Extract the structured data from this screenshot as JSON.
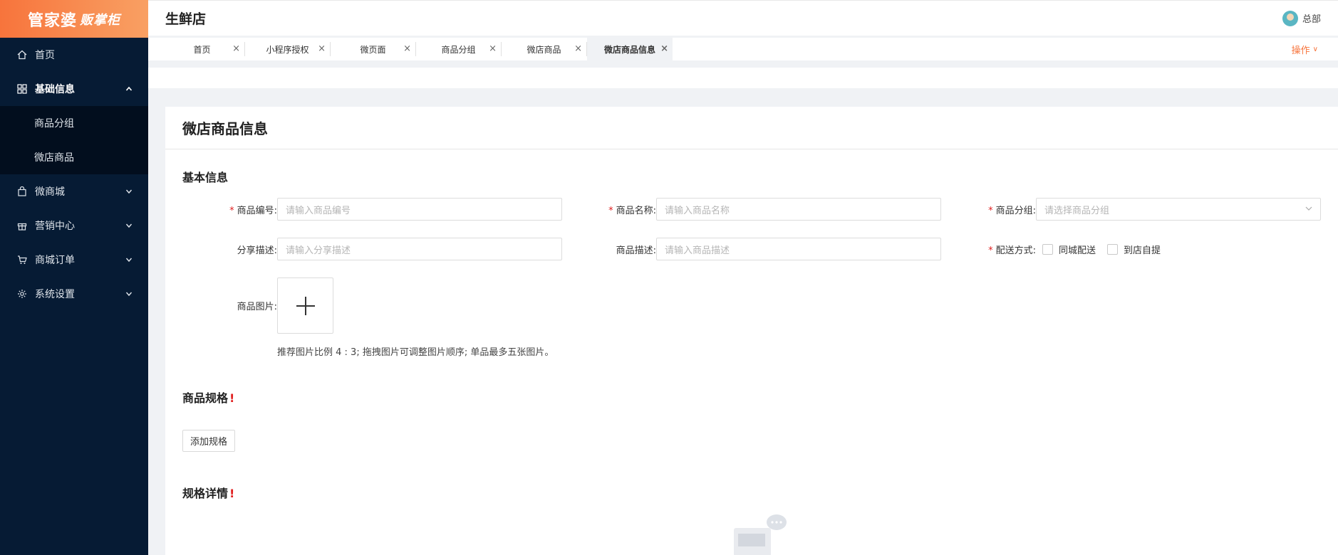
{
  "brand": {
    "name": "管家婆",
    "sub": "贩掌柜"
  },
  "header": {
    "store": "生鲜店",
    "user": "总部"
  },
  "sidebar": {
    "items": [
      {
        "label": "首页",
        "icon": "home-icon"
      },
      {
        "label": "基础信息",
        "icon": "grid-icon",
        "open": true,
        "children": [
          "商品分组",
          "微店商品"
        ]
      },
      {
        "label": "微商城",
        "icon": "bag-icon"
      },
      {
        "label": "营销中心",
        "icon": "gift-icon"
      },
      {
        "label": "商城订单",
        "icon": "cart-icon"
      },
      {
        "label": "系统设置",
        "icon": "gear-icon"
      }
    ]
  },
  "tabs": {
    "items": [
      "首页",
      "小程序授权",
      "微页面",
      "商品分组",
      "微店商品",
      "微店商品信息"
    ],
    "close": "×",
    "ops_label": "操作",
    "ops_chevron": "∨"
  },
  "page": {
    "title": "微店商品信息"
  },
  "basic": {
    "title": "基本信息",
    "req_mark": "*",
    "code_label": "商品编号:",
    "code_placeholder": "请输入商品编号",
    "name_label": "商品名称:",
    "name_placeholder": "请输入商品名称",
    "group_label": "商品分组:",
    "group_placeholder": "请选择商品分组",
    "share_label": "分享描述:",
    "share_placeholder": "请输入分享描述",
    "desc_label": "商品描述:",
    "desc_placeholder": "请输入商品描述",
    "delivery_label": "配送方式:",
    "delivery_options": [
      "同城配送",
      "到店自提"
    ],
    "image_label": "商品图片:",
    "image_hint": "推荐图片比例 4 : 3;  拖拽图片可调整图片顺序;  单品最多五张图片。"
  },
  "spec": {
    "title": "商品规格",
    "mark": "!",
    "add_button": "添加规格"
  },
  "spec_detail": {
    "title": "规格详情",
    "mark": "!"
  }
}
